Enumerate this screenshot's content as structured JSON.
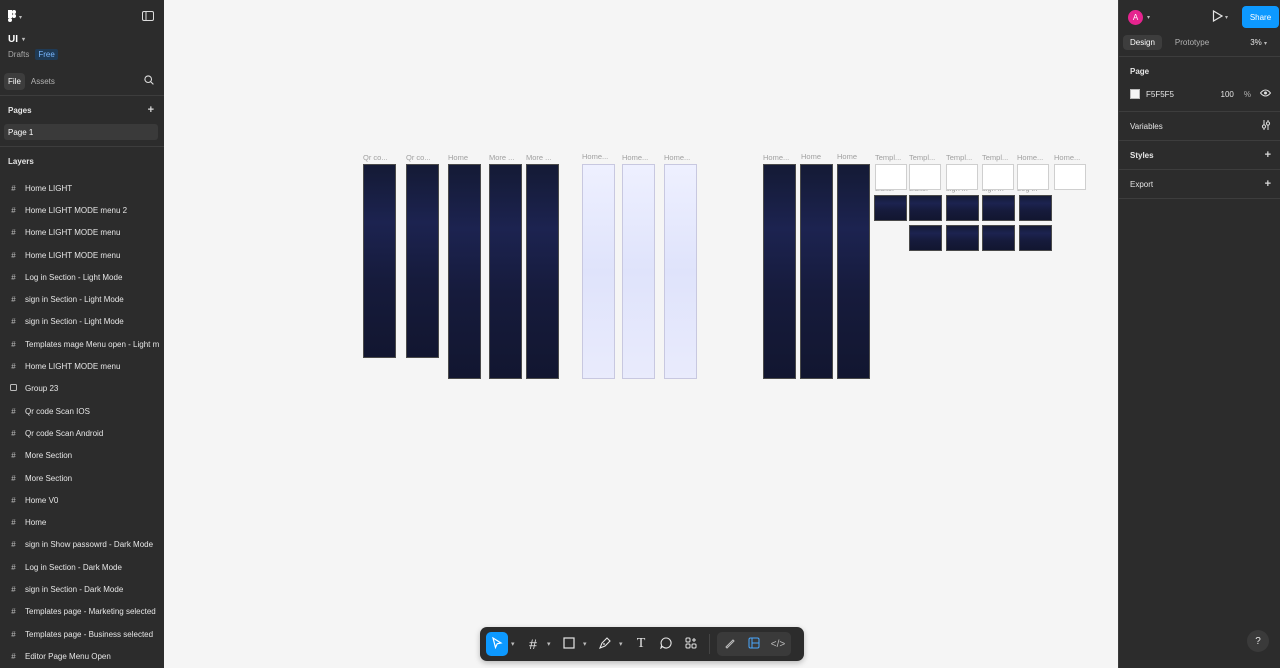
{
  "file": {
    "title": "UI",
    "location": "Drafts",
    "plan_badge": "Free"
  },
  "left_tabs": {
    "file": "File",
    "assets": "Assets"
  },
  "pages": {
    "heading": "Pages",
    "items": [
      "Page 1"
    ]
  },
  "layers": {
    "heading": "Layers",
    "items": [
      {
        "label": "Home LIGHT",
        "icon": "frame-icon"
      },
      {
        "label": "Home LIGHT MODE menu 2",
        "icon": "frame-icon"
      },
      {
        "label": "Home LIGHT MODE menu",
        "icon": "frame-icon"
      },
      {
        "label": "Home LIGHT MODE menu",
        "icon": "frame-icon"
      },
      {
        "label": "Log in Section - Light Mode",
        "icon": "frame-icon"
      },
      {
        "label": "sign in Section - Light Mode",
        "icon": "frame-icon"
      },
      {
        "label": "sign in Section - Light Mode",
        "icon": "frame-icon"
      },
      {
        "label": "Templates mage Menu open - Light m",
        "icon": "frame-icon"
      },
      {
        "label": "Home LIGHT MODE menu",
        "icon": "frame-icon"
      },
      {
        "label": "Group 23",
        "icon": "group-icon"
      },
      {
        "label": "Qr code Scan  IOS",
        "icon": "frame-icon"
      },
      {
        "label": "Qr code Scan  Android",
        "icon": "frame-icon"
      },
      {
        "label": "More Section",
        "icon": "frame-icon"
      },
      {
        "label": "More Section",
        "icon": "frame-icon"
      },
      {
        "label": "Home V0",
        "icon": "frame-icon"
      },
      {
        "label": "Home",
        "icon": "frame-icon"
      },
      {
        "label": "sign in Show passowrd - Dark Mode",
        "icon": "frame-icon"
      },
      {
        "label": "Log in Section - Dark Mode",
        "icon": "frame-icon"
      },
      {
        "label": "sign in Section - Dark Mode",
        "icon": "frame-icon"
      },
      {
        "label": "Templates page - Marketing selected",
        "icon": "frame-icon"
      },
      {
        "label": "Templates page - Business selected",
        "icon": "frame-icon"
      },
      {
        "label": "Editor Page Menu Open",
        "icon": "frame-icon"
      }
    ]
  },
  "right_panel": {
    "avatar_initial": "A",
    "share_label": "Share",
    "tabs": {
      "design": "Design",
      "prototype": "Prototype"
    },
    "zoom": "3%",
    "page": {
      "heading": "Page",
      "color_hex": "F5F5F5",
      "opacity": "100",
      "percent": "%"
    },
    "variables": "Variables",
    "styles": "Styles",
    "export": "Export"
  },
  "canvas_labels": {
    "qr1": "Qr co...",
    "qr2": "Qr co...",
    "home1": "Home",
    "more1": "More ...",
    "more2": "More ...",
    "light1": "Home...",
    "light2": "Home...",
    "light3": "Home...",
    "dark1": "Home...",
    "dark2": "Home",
    "dark3": "Home",
    "t1": "Templ...",
    "t2": "Templ...",
    "t3": "Templ...",
    "t4": "Templ...",
    "t5": "Home...",
    "t6": "Home...",
    "s1": "Editor",
    "s2": "Editor",
    "s3": "sign in",
    "s4": "sign in",
    "s5": "Log in"
  },
  "colors": {
    "accent": "#0d99ff",
    "panel": "#2c2c2c",
    "canvas": "#f5f5f5",
    "avatar": "#e6248f"
  }
}
